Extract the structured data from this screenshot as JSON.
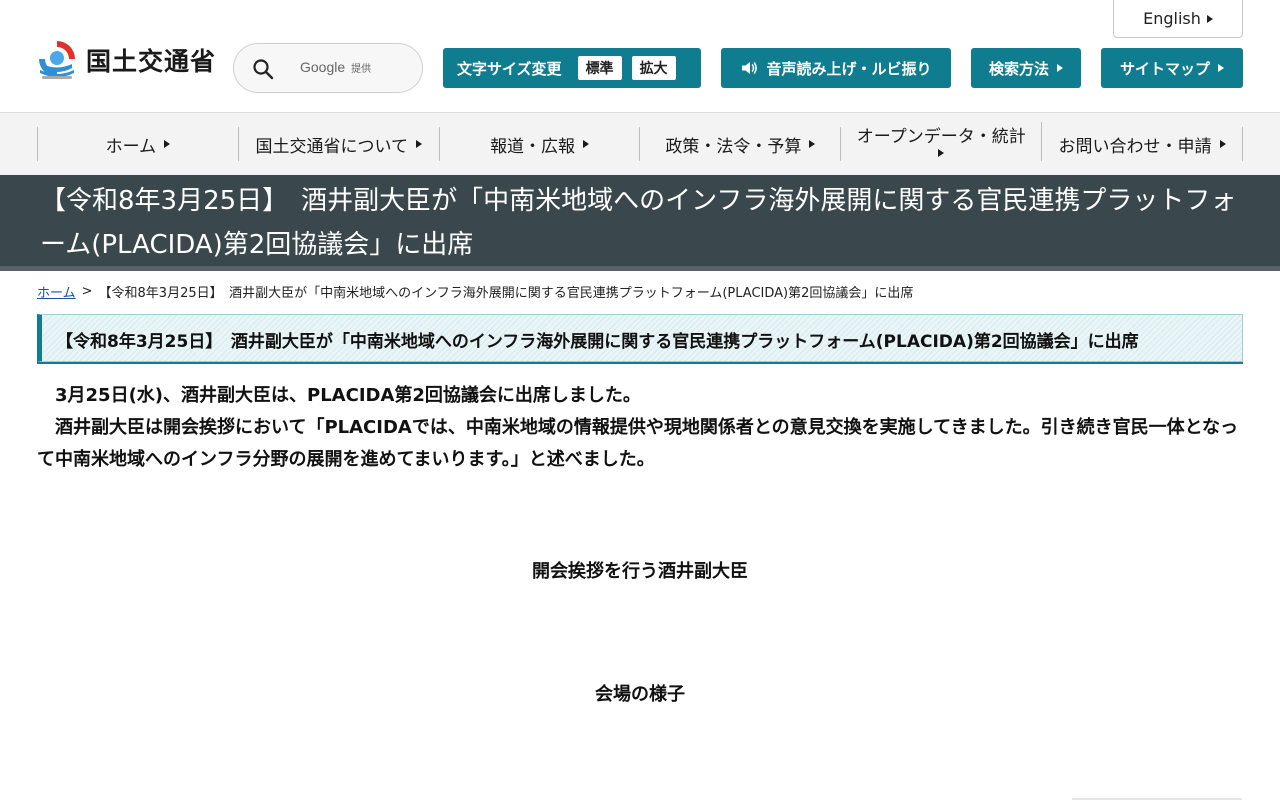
{
  "header": {
    "english_label": "English",
    "logo_text": "国土交通省",
    "search": {
      "placeholder": "",
      "provider": "Google",
      "provider_suffix": "提供"
    },
    "font_size": {
      "label": "文字サイズ変更",
      "standard": "標準",
      "large": "拡大"
    },
    "voice_label": "音声読み上げ・ルビ振り",
    "search_method_label": "検索方法",
    "sitemap_label": "サイトマップ"
  },
  "nav": {
    "items": [
      {
        "label": "ホーム"
      },
      {
        "label": "国土交通省について"
      },
      {
        "label": "報道・広報"
      },
      {
        "label": "政策・法令・予算"
      },
      {
        "label": "オープンデータ・統計"
      },
      {
        "label": "お問い合わせ・申請"
      }
    ]
  },
  "page": {
    "title": "【令和8年3月25日】　酒井副大臣が「中南米地域へのインフラ海外展開に関する官民連携プラットフォーム(PLACIDA)第2回協議会」に出席",
    "breadcrumb": {
      "home": "ホーム",
      "separator": ">",
      "current": "【令和8年3月25日】　酒井副大臣が「中南米地域へのインフラ海外展開に関する官民連携プラットフォーム(PLACIDA)第2回協議会」に出席"
    },
    "section_heading": "【令和8年3月25日】　酒井副大臣が「中南米地域へのインフラ海外展開に関する官民連携プラットフォーム(PLACIDA)第2回協議会」に出席",
    "paragraph_1": "3月25日(水)、酒井副大臣は、PLACIDA第2回協議会に出席しました。",
    "paragraph_2": "酒井副大臣は開会挨拶において「PLACIDAでは、中南米地域の情報提供や現地関係者との意見交換を実施してきました。引き続き官民一体となって中南米地域へのインフラ分野の展開を進めてまいります。」と述べました。",
    "caption_1": "開会挨拶を行う酒井副大臣",
    "caption_2": "会場の様子"
  },
  "colors": {
    "accent": "#0f7c8f",
    "title_band": "#3a474d",
    "nav_bg": "#f3f3f3"
  }
}
